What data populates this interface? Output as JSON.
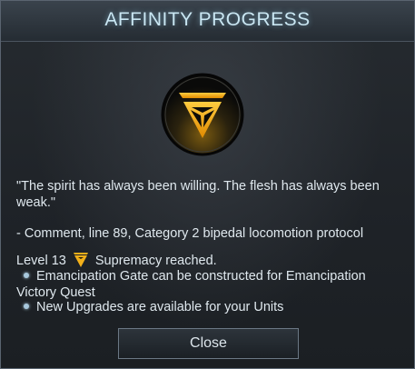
{
  "dialog": {
    "title": "AFFINITY PROGRESS",
    "emblem_icon": "supremacy-affinity-icon",
    "quote": "\"The spirit has always been willing. The flesh has always been weak.\"",
    "comment": "- Comment, line 89, Category 2 bipedal locomotion protocol",
    "level_prefix": "Level 13",
    "level_suffix": "Supremacy reached.",
    "bullets": [
      "Emancipation Gate can be constructed for Emancipation Victory Quest",
      "New Upgrades are available for your Units"
    ],
    "close_label": "Close"
  },
  "colors": {
    "accent": "#f0a800",
    "title": "#c9e6f2",
    "text": "#dfe8ee"
  }
}
